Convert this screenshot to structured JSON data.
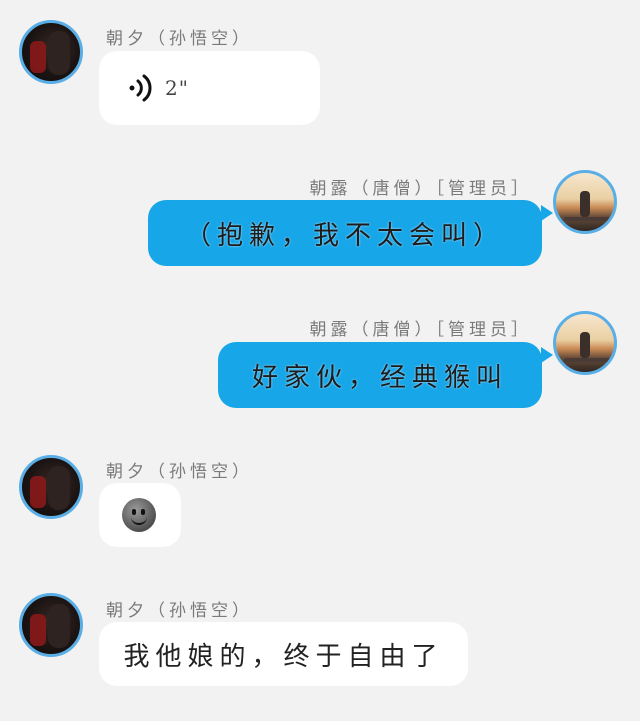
{
  "messages": [
    {
      "sender": "朝夕（孙悟空）",
      "voice_duration": "2\""
    },
    {
      "sender": "朝露（唐僧）［管理员］",
      "text": "（抱歉，我不太会叫）"
    },
    {
      "sender": "朝露（唐僧）［管理员］",
      "text": "好家伙，经典猴叫"
    },
    {
      "sender": "朝夕（孙悟空）",
      "emoji": "slightly-smiling-face"
    },
    {
      "sender": "朝夕（孙悟空）",
      "text": "我他娘的，终于自由了"
    }
  ],
  "colors": {
    "background": "#f2f2f2",
    "outgoing_bubble": "#17a6e8",
    "incoming_bubble": "#ffffff",
    "avatar_ring": "#5aaee6"
  }
}
